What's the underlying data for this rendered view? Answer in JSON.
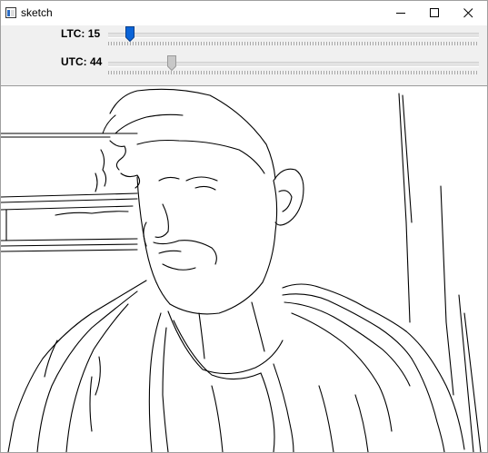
{
  "window": {
    "title": "sketch",
    "icon": "app-window-icon",
    "controls": [
      "minimize-icon",
      "maximize-icon",
      "close-icon"
    ]
  },
  "trackbars": [
    {
      "label": "LTC: 15",
      "value": 15,
      "max": 255,
      "thumb_color": "#0a64d8",
      "active": true
    },
    {
      "label": "UTC: 44",
      "value": 44,
      "max": 255,
      "thumb_color": "#c8c8c8",
      "active": false
    }
  ],
  "image": {
    "content": "edge-detection-sketch",
    "line_color": "#000000",
    "background": "#ffffff"
  }
}
